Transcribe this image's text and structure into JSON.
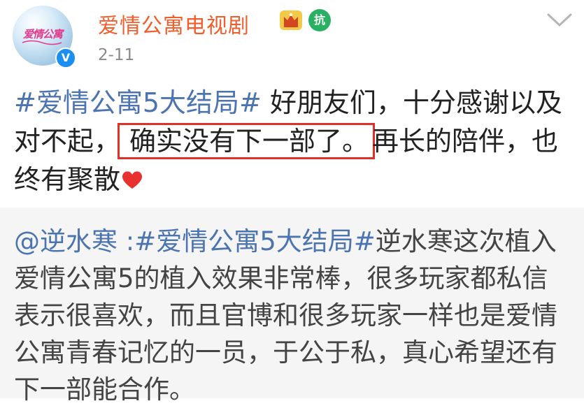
{
  "user": {
    "name": "爱情公寓电视剧",
    "avatar_text": "爱情公寓",
    "verified_badge": "V",
    "fight_badge": "抗",
    "date": "2-11"
  },
  "post": {
    "hashtag": "#爱情公寓5大结局#",
    "text_a": " 好朋友们，十分感谢以及对不起，",
    "highlight": "确实没有下一部了。",
    "text_b": "再长的陪伴，也终有聚散"
  },
  "repost": {
    "mention": "@逆水寒",
    "sep": " :",
    "hashtag": "#爱情公寓5大结局#",
    "text": "逆水寒这次植入爱情公寓5的植入效果非常棒，很多玩家都私信表示很喜欢，而且官博和很多玩家一样也是爱情公寓青春记忆的一员，于公于私，真心希望还有下一部能合作。"
  },
  "colors": {
    "username": "#f15e2c",
    "link": "#4c74b0",
    "highlight_border": "#e0302b",
    "heart": "#e8312f"
  },
  "icons": [
    "crown-icon",
    "fight-badge-icon",
    "verified-icon",
    "chevron-down-icon",
    "heart-icon"
  ]
}
